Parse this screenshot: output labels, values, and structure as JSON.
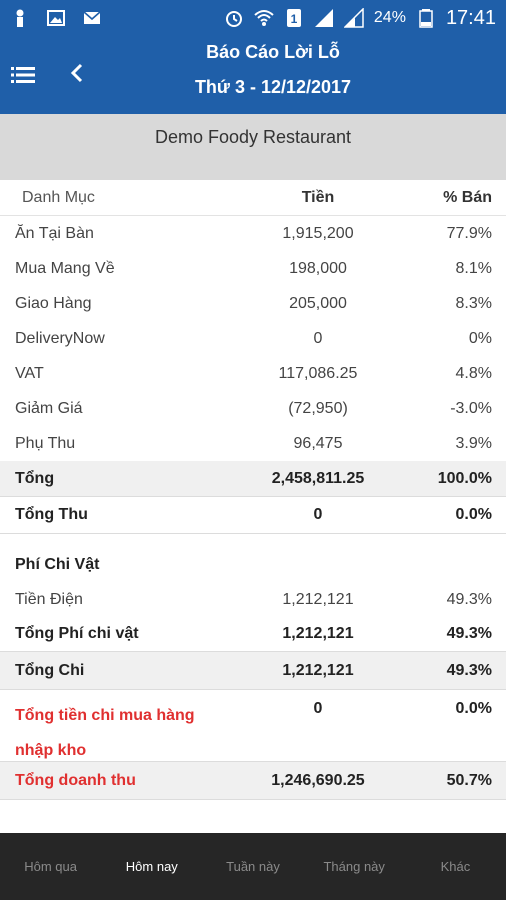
{
  "status_bar": {
    "battery": "24%",
    "time": "17:41"
  },
  "header": {
    "title": "Báo Cáo Lời Lỗ",
    "date": "Thứ 3 - 12/12/2017"
  },
  "restaurant": "Demo Foody Restaurant",
  "table": {
    "columns": [
      "Danh Mục",
      "Tiền",
      "% Bán"
    ],
    "revenue_rows": [
      {
        "label": "Ăn Tại Bàn",
        "amount": "1,915,200",
        "percent": "77.9%"
      },
      {
        "label": "Mua Mang Về",
        "amount": "198,000",
        "percent": "8.1%"
      },
      {
        "label": "Giao Hàng",
        "amount": "205,000",
        "percent": "8.3%"
      },
      {
        "label": "DeliveryNow",
        "amount": "0",
        "percent": "0%"
      },
      {
        "label": "VAT",
        "amount": "117,086.25",
        "percent": "4.8%"
      },
      {
        "label": "Giảm Giá",
        "amount": "(72,950)",
        "percent": "-3.0%"
      },
      {
        "label": "Phụ Thu",
        "amount": "96,475",
        "percent": "3.9%"
      }
    ],
    "total": {
      "label": "Tổng",
      "amount": "2,458,811.25",
      "percent": "100.0%"
    },
    "total_receipts": {
      "label": "Tổng Thu",
      "amount": "0",
      "percent": "0.0%"
    },
    "expense_section": "Phí Chi Vật",
    "expense_rows": [
      {
        "label": "Tiền Điện",
        "amount": "1,212,121",
        "percent": "49.3%"
      }
    ],
    "total_expense_items": {
      "label": "Tổng Phí chi vật",
      "amount": "1,212,121",
      "percent": "49.3%"
    },
    "total_spend": {
      "label": "Tổng Chi",
      "amount": "1,212,121",
      "percent": "49.3%"
    },
    "stock_purchase": {
      "label": "Tổng tiền chi mua hàng nhập kho",
      "amount": "0",
      "percent": "0.0%"
    },
    "net_revenue": {
      "label": "Tổng doanh thu",
      "amount": "1,246,690.25",
      "percent": "50.7%"
    }
  },
  "bottom_nav": {
    "items": [
      "Hôm qua",
      "Hôm nay",
      "Tuần này",
      "Tháng này",
      "Khác"
    ],
    "active": "Hôm nay"
  },
  "colors": {
    "primary": "#1f5fa9",
    "accent_red": "#e03030",
    "nav_bg": "#262626"
  }
}
